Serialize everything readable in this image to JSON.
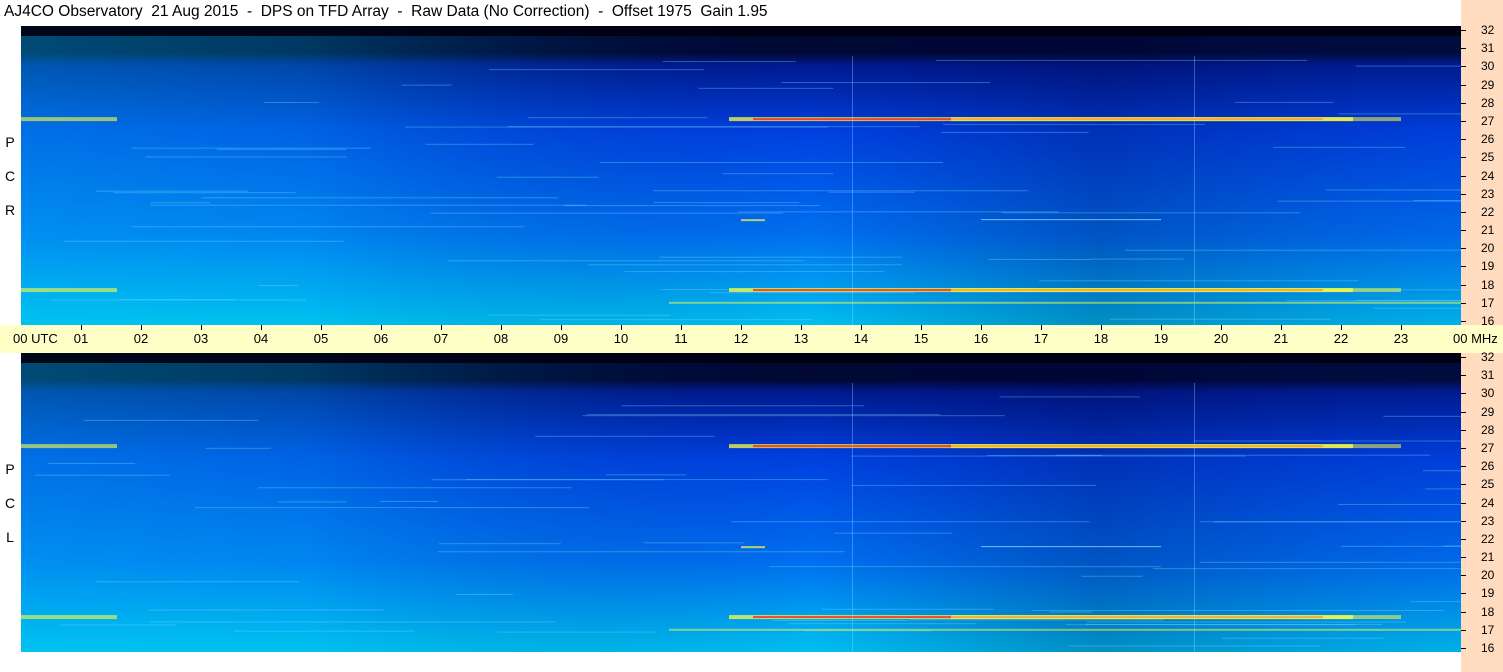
{
  "title": "AJ4CO Observatory  21 Aug 2015  -  DPS on TFD Array  -  Raw Data (No Correction)  -  Offset 1975  Gain 1.95",
  "panels": [
    {
      "id": "rcp",
      "label_letters": [
        "R",
        "C",
        "P"
      ]
    },
    {
      "id": "lcp",
      "label_letters": [
        "L",
        "C",
        "P"
      ]
    }
  ],
  "time_axis": {
    "first_label": "00  UTC",
    "last_label": "00 MHz",
    "labels": [
      "01",
      "02",
      "03",
      "04",
      "05",
      "06",
      "07",
      "08",
      "09",
      "10",
      "11",
      "12",
      "13",
      "14",
      "15",
      "16",
      "17",
      "18",
      "19",
      "20",
      "21",
      "22",
      "23"
    ]
  },
  "colors": {
    "deep": "#000833",
    "dark_blue": "#001a90",
    "blue": "#0040e0",
    "mid_blue": "#0070f0",
    "cyan": "#00c0f0",
    "yellow": "#ffff40",
    "red": "#ff2020"
  },
  "chart_data": {
    "type": "heatmap",
    "x_label": "UTC",
    "y_unit": "MHz",
    "x_range_hours": [
      0,
      24
    ],
    "y_range_mhz": [
      16,
      32
    ],
    "y_ticks": [
      32,
      31,
      30,
      29,
      28,
      27,
      26,
      25,
      24,
      23,
      22,
      21,
      20,
      19,
      18,
      17,
      16
    ],
    "bright_bands_mhz": [
      {
        "freq": 27.1,
        "intensity": "high"
      },
      {
        "freq": 17.7,
        "intensity": "high"
      },
      {
        "freq": 17.0,
        "intensity": "medium"
      },
      {
        "freq": 21.6,
        "intensity": "low"
      }
    ]
  }
}
